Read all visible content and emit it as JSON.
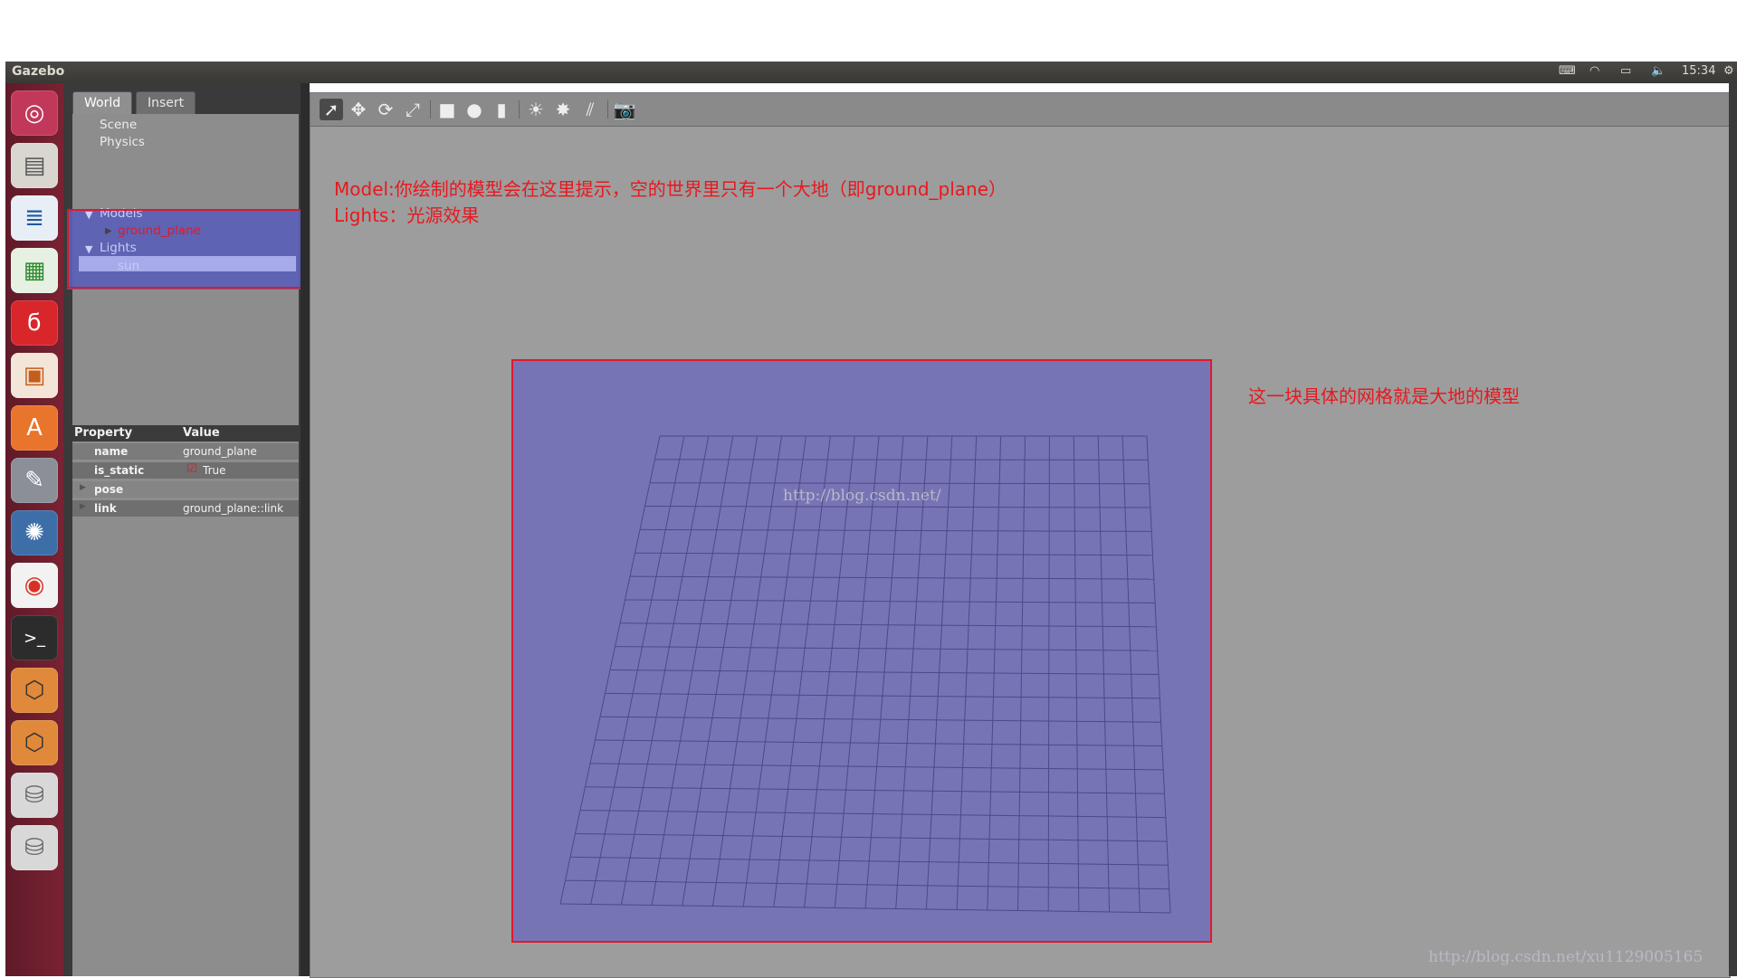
{
  "app": {
    "title": "Gazebo",
    "clock": "15:34"
  },
  "tray_icons": [
    "keyboard-icon",
    "wifi-icon",
    "battery-icon",
    "volume-icon",
    "settings-icon"
  ],
  "launcher": [
    "ubuntu-logo-icon",
    "files-icon",
    "writer-icon",
    "calc-icon",
    "netease-music-icon",
    "impress-icon",
    "software-center-icon",
    "system-settings-icon",
    "shutter-icon",
    "chrome-icon",
    "terminal-icon",
    "sublime-text-icon",
    "sublime-text-icon-2",
    "drive-icon",
    "drive-icon-2"
  ],
  "tabs": {
    "world": "World",
    "insert": "Insert"
  },
  "tree": {
    "scene": "Scene",
    "physics": "Physics",
    "models": "Models",
    "ground_plane": "ground_plane",
    "lights": "Lights",
    "sun": "sun"
  },
  "properties": {
    "headers": {
      "property": "Property",
      "value": "Value"
    },
    "rows": [
      {
        "name": "name",
        "value": "ground_plane"
      },
      {
        "name": "is_static",
        "value": "True"
      },
      {
        "name": "pose",
        "value": ""
      },
      {
        "name": "link",
        "value": "ground_plane::link"
      }
    ]
  },
  "annotations": {
    "models_line1": "Model:你绘制的模型会在这里提示，空的世界里只有一个大地（即ground_plane）",
    "models_line2": "Lights：光源效果",
    "ground": "这一块具体的网格就是大地的模型"
  },
  "watermarks": {
    "center": "http://blog.csdn.net/",
    "corner": "http://blog.csdn.net/xu1129005165"
  },
  "colors": {
    "annotation": "#e0182c",
    "highlight": "#5b5fb6",
    "ground": "#7774b6",
    "launcher": "#6b1c2e"
  }
}
